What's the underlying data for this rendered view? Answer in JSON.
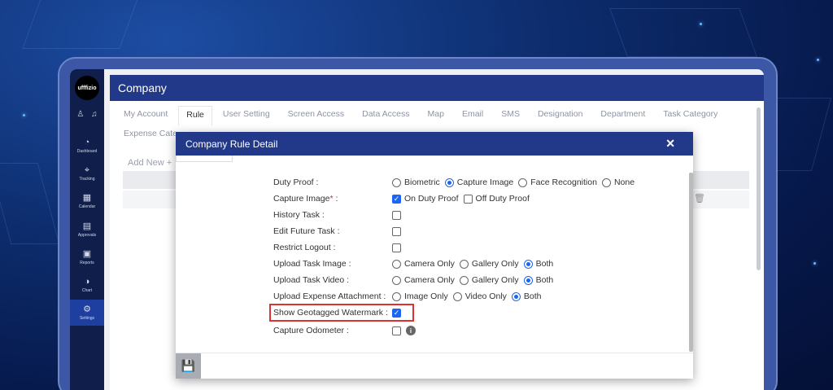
{
  "app": {
    "logo_text": "ufffizio",
    "header_title": "Company"
  },
  "sidebar": {
    "items": [
      {
        "label": "Dashboard",
        "icon": "dashboard-icon",
        "glyph": "◔"
      },
      {
        "label": "Tracking",
        "icon": "tracking-icon",
        "glyph": "⌖"
      },
      {
        "label": "Calendar",
        "icon": "calendar-icon",
        "glyph": "▦"
      },
      {
        "label": "Approvals",
        "icon": "approvals-icon",
        "glyph": "▤"
      },
      {
        "label": "Reports",
        "icon": "reports-icon",
        "glyph": "▣"
      },
      {
        "label": "Chart",
        "icon": "chart-icon",
        "glyph": "◑"
      },
      {
        "label": "Settings",
        "icon": "settings-icon",
        "glyph": "⚙"
      }
    ]
  },
  "tabs": [
    "My Account",
    "Rule",
    "User Setting",
    "Screen Access",
    "Data Access",
    "Map",
    "Email",
    "SMS",
    "Designation",
    "Department",
    "Task Category",
    "Expense Cate"
  ],
  "page": {
    "add_new_label": "Add New"
  },
  "modal": {
    "title": "Company Rule Detail",
    "rows": {
      "duty_proof": {
        "label": "Duty Proof :",
        "options": [
          "Biometric",
          "Capture Image",
          "Face Recognition",
          "None"
        ],
        "selected": "Capture Image"
      },
      "capture_image": {
        "label": "Capture Image",
        "required_mark": "*",
        "suffix": " :",
        "options": [
          "On Duty Proof",
          "Off Duty Proof"
        ],
        "checked": [
          "On Duty Proof"
        ]
      },
      "history_task": {
        "label": "History Task :",
        "checked": false
      },
      "edit_future_task": {
        "label": "Edit Future Task :",
        "checked": false
      },
      "restrict_logout": {
        "label": "Restrict Logout :",
        "checked": false
      },
      "upload_task_image": {
        "label": "Upload Task Image :",
        "options": [
          "Camera Only",
          "Gallery Only",
          "Both"
        ],
        "selected": "Both"
      },
      "upload_task_video": {
        "label": "Upload Task Video :",
        "options": [
          "Camera Only",
          "Gallery Only",
          "Both"
        ],
        "selected": "Both"
      },
      "upload_expense_attachment": {
        "label": "Upload Expense Attachment :",
        "options": [
          "Image Only",
          "Video Only",
          "Both"
        ],
        "selected": "Both"
      },
      "show_geotagged_watermark": {
        "label": "Show Geotagged Watermark :",
        "checked": true
      },
      "capture_odometer": {
        "label": "Capture Odometer :",
        "checked": false
      }
    }
  },
  "colors": {
    "header": "#22398a",
    "accent": "#1c64f2",
    "highlight": "#e03131"
  }
}
